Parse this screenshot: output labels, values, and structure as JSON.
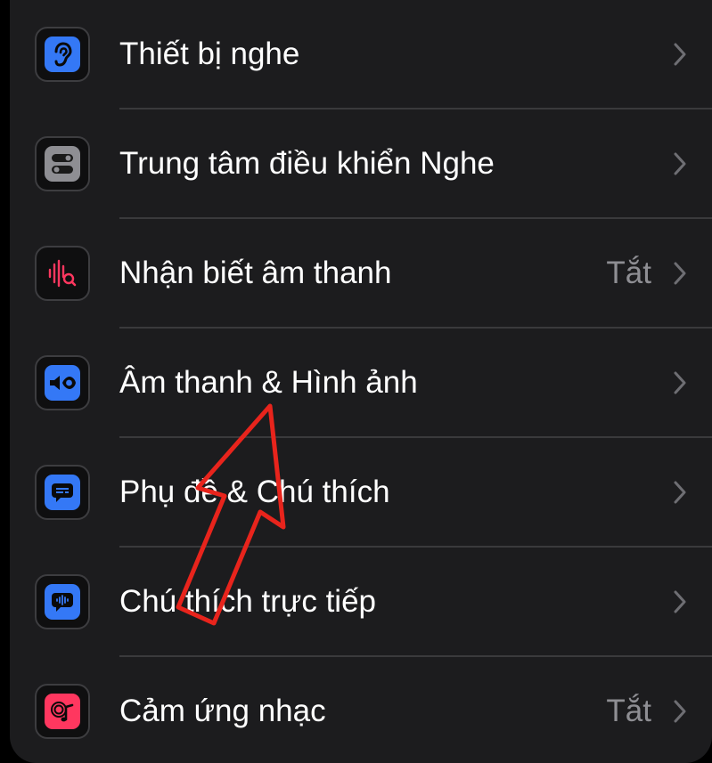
{
  "settings": {
    "items": [
      {
        "label": "Thiết bị nghe",
        "value": "",
        "icon": "ear-icon"
      },
      {
        "label": "Trung tâm điều khiển Nghe",
        "value": "",
        "icon": "toggles-icon"
      },
      {
        "label": "Nhận biết âm thanh",
        "value": "Tắt",
        "icon": "sound-recognition-icon"
      },
      {
        "label": "Âm thanh & Hình ảnh",
        "value": "",
        "icon": "speaker-eye-icon"
      },
      {
        "label": "Phụ đề & Chú thích",
        "value": "",
        "icon": "subtitles-icon"
      },
      {
        "label": "Chú thích trực tiếp",
        "value": "",
        "icon": "live-captions-icon"
      },
      {
        "label": "Cảm ứng nhạc",
        "value": "Tắt",
        "icon": "music-haptics-icon"
      }
    ]
  },
  "annotation": {
    "icon": "red-arrow-icon",
    "color": "#e8241c"
  },
  "colors": {
    "background": "#1c1c1e",
    "separator": "#3a3a3c",
    "label": "#ffffff",
    "secondary": "#8e8e93",
    "blue": "#3478f6",
    "pink": "#ff375f"
  }
}
